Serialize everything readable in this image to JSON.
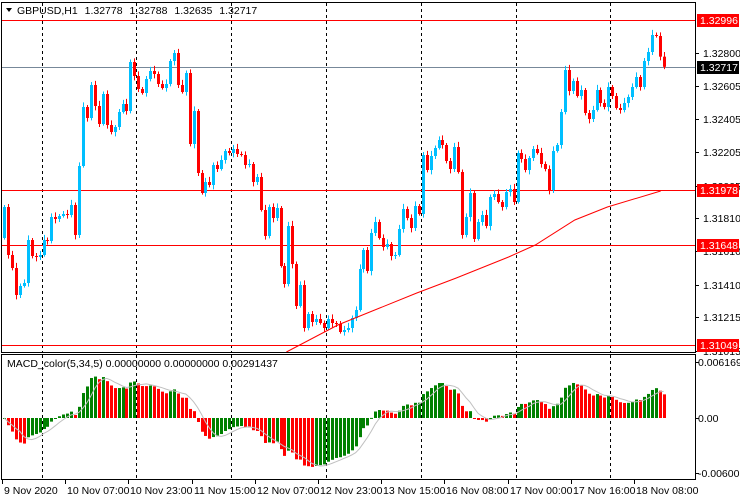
{
  "header": {
    "menu_icon": "triangle-down-icon",
    "symbol": "GBPUSD,H1",
    "open": "1.32778",
    "high": "1.32788",
    "low": "1.32635",
    "close": "1.32717"
  },
  "chart_data": {
    "type": "candlestick",
    "title": "GBPUSD,H1",
    "first_open": 1.3169,
    "closes": [
      1.31876,
      1.31588,
      1.3151,
      1.31348,
      1.31402,
      1.3142,
      1.31678,
      1.31582,
      1.31576,
      1.31588,
      1.31678,
      1.31672,
      1.31816,
      1.31804,
      1.31822,
      1.31834,
      1.31828,
      1.31888,
      1.31708,
      1.32122,
      1.32476,
      1.3241,
      1.32608,
      1.32482,
      1.32374,
      1.32554,
      1.32368,
      1.32326,
      1.32356,
      1.32446,
      1.32494,
      1.32452,
      1.32746,
      1.32662,
      1.32584,
      1.3256,
      1.32644,
      1.32692,
      1.32674,
      1.32614,
      1.3259,
      1.32614,
      1.32752,
      1.328,
      1.32608,
      1.32566,
      1.3268,
      1.32254,
      1.32452,
      1.3208,
      1.3196,
      1.32026,
      1.32008,
      1.32128,
      1.32104,
      1.32158,
      1.32212,
      1.322,
      1.32224,
      1.32194,
      1.32188,
      1.32128,
      1.32134,
      1.32026,
      1.32056,
      1.31858,
      1.31702,
      1.31876,
      1.3181,
      1.3187,
      1.31522,
      1.31414,
      1.31762,
      1.31534,
      1.31282,
      1.31408,
      1.3115,
      1.31234,
      1.31186,
      1.31204,
      1.3118,
      1.3115,
      1.31204,
      1.3118,
      1.31174,
      1.31126,
      1.31138,
      1.3115,
      1.3121,
      1.31258,
      1.31504,
      1.31618,
      1.31492,
      1.3172,
      1.31786,
      1.3169,
      1.31636,
      1.31654,
      1.31582,
      1.31588,
      1.31744,
      1.31864,
      1.3181,
      1.3175,
      1.31882,
      1.31834,
      1.32188,
      1.32098,
      1.32182,
      1.3223,
      1.32278,
      1.32248,
      1.32152,
      1.32104,
      1.32236,
      1.32086,
      1.31708,
      1.31816,
      1.3196,
      1.31684,
      1.31786,
      1.31828,
      1.31762,
      1.31936,
      1.31954,
      1.31906,
      1.31876,
      1.31966,
      1.31984,
      1.31906,
      1.322,
      1.32164,
      1.32098,
      1.3217,
      1.32224,
      1.322,
      1.32134,
      1.32104,
      1.31978,
      1.32212,
      1.32248,
      1.32446,
      1.32698,
      1.32572,
      1.32632,
      1.32542,
      1.32578,
      1.3244,
      1.32404,
      1.32458,
      1.32578,
      1.325,
      1.32476,
      1.32596,
      1.32542,
      1.3247,
      1.32458,
      1.325,
      1.32536,
      1.32596,
      1.32656,
      1.32596,
      1.32752,
      1.32806,
      1.32908,
      1.32902,
      1.32778,
      1.32717
    ],
    "moving_average": [
      [
        71.5,
        1.31006
      ],
      [
        84.5,
        1.31168
      ],
      [
        104.5,
        1.3136
      ],
      [
        114.5,
        1.3145
      ],
      [
        127.75,
        1.31576
      ],
      [
        134.5,
        1.31648
      ],
      [
        144.5,
        1.31798
      ],
      [
        152.75,
        1.31876
      ],
      [
        166.25,
        1.31972
      ]
    ],
    "ylim": [
      1.31006,
      1.331
    ],
    "y_ticks": [
      "1.32800",
      "1.32605",
      "1.32405",
      "1.32205",
      "1.32005",
      "1.31810",
      "1.31610",
      "1.31410",
      "1.31215",
      "1.31015"
    ],
    "levels": [
      {
        "value": "1.32996",
        "color": "#ff0000"
      },
      {
        "value": "1.31978",
        "color": "#ff0000"
      },
      {
        "value": "1.31648",
        "color": "#ff0000"
      },
      {
        "value": "1.31049",
        "color": "#ff0000"
      }
    ],
    "current_price": "1.32717",
    "x_tick_labels": [
      "9 Nov 2020",
      "10 Nov 07:00",
      "10 Nov 23:00",
      "11 Nov 15:00",
      "12 Nov 07:00",
      "12 Nov 23:00",
      "13 Nov 15:00",
      "16 Nov 08:00",
      "17 Nov 00:00",
      "17 Nov 16:00",
      "18 Nov 08:00"
    ],
    "colors": {
      "bull": "#00bfff",
      "bear": "#ff0000",
      "ma": "#ff0000",
      "current": "#778899",
      "grid": "#000000"
    }
  },
  "macd": {
    "label": "MACD_color(5,34,5) 0.00000000 0.00000000 0.00291437",
    "fast": 5,
    "slow": 34,
    "signal": 5,
    "ylim": [
      -0.006005,
      0.0061695
    ],
    "ticks": [
      "0.0061695",
      "0.00",
      "-0.006005"
    ],
    "colors": {
      "up": "#008000",
      "down": "#ff0000",
      "signal": "#c0c0c0"
    }
  }
}
